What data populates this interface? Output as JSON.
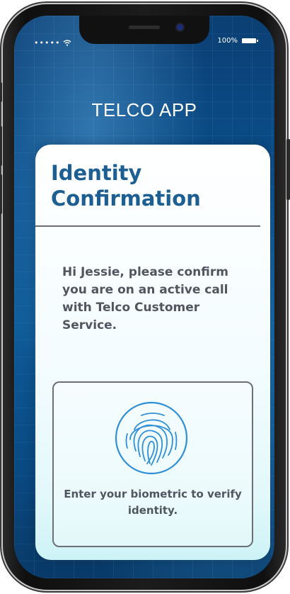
{
  "status_bar": {
    "signal": "•••••",
    "battery": "100%"
  },
  "app": {
    "title": "TELCO APP"
  },
  "card": {
    "title": "Identity Confirmation",
    "message": "Hi Jessie, please confirm you are on an active call with Telco Customer Service.",
    "biometric_prompt": "Enter your biometric to verify identity."
  },
  "icons": {
    "wifi": "wifi-icon",
    "battery": "battery-icon",
    "fingerprint": "fingerprint-icon"
  },
  "colors": {
    "title_blue": "#1d5f93",
    "fingerprint_blue": "#2f8fd8",
    "text_gray": "#505660"
  }
}
